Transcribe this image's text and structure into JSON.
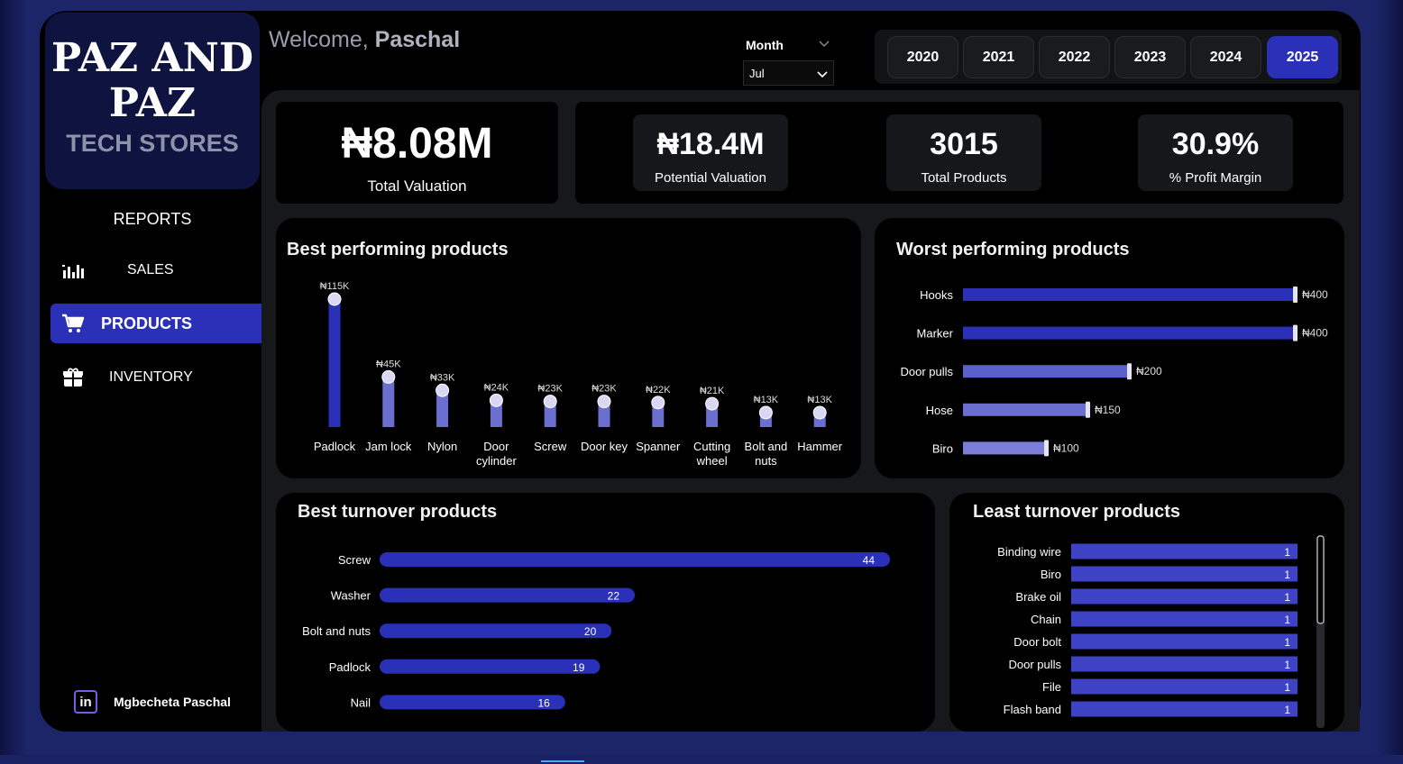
{
  "sidebar": {
    "logo_line1": "PAZ AND",
    "logo_line2": "PAZ",
    "logo_line3": "TECH STORES",
    "reports_title": "REPORTS",
    "nav": [
      {
        "label": "SALES",
        "icon": "sales-chart-icon"
      },
      {
        "label": "PRODUCTS",
        "icon": "cart-icon",
        "active": true
      },
      {
        "label": "INVENTORY",
        "icon": "inventory-box-icon"
      }
    ],
    "footer_name": "Mgbecheta Paschal",
    "footer_icon_text": "in"
  },
  "header": {
    "welcome_prefix": "Welcome,",
    "welcome_name": "Paschal",
    "month_label": "Month",
    "month_value": "Jul",
    "years": [
      "2020",
      "2021",
      "2022",
      "2023",
      "2024",
      "2025"
    ],
    "active_year": "2025"
  },
  "kpis": {
    "total_valuation": {
      "value": "₦8.08M",
      "label": "Total Valuation"
    },
    "cards": [
      {
        "value": "₦18.4M",
        "label": "Potential Valuation"
      },
      {
        "value": "3015",
        "label": "Total Products"
      },
      {
        "value": "30.9%",
        "label": "% Profit Margin"
      }
    ]
  },
  "colors": {
    "accent": "#2a31b8",
    "bar_dark": "#2a31b8",
    "bar_light": "#6a6fd0",
    "panel": "#17181c"
  },
  "chart_data": [
    {
      "type": "bar",
      "title": "Best performing products",
      "categories": [
        "Padlock",
        "Jam lock",
        "Nylon",
        "Door cylinder",
        "Screw",
        "Door key",
        "Spanner",
        "Cutting wheel",
        "Bolt and nuts",
        "Hammer"
      ],
      "category_lines": [
        [
          "Padlock"
        ],
        [
          "Jam lock"
        ],
        [
          "Nylon"
        ],
        [
          "Door",
          "cylinder"
        ],
        [
          "Screw"
        ],
        [
          "Door key"
        ],
        [
          "Spanner"
        ],
        [
          "Cutting",
          "wheel"
        ],
        [
          "Bolt and",
          "nuts"
        ],
        [
          "Hammer"
        ]
      ],
      "values": [
        115000,
        45000,
        33000,
        24000,
        23000,
        23000,
        22000,
        21000,
        13000,
        13000
      ],
      "labels": [
        "₦115K",
        "₦45K",
        "₦33K",
        "₦24K",
        "₦23K",
        "₦23K",
        "₦22K",
        "₦21K",
        "₦13K",
        "₦13K"
      ],
      "ylim": [
        0,
        115000
      ]
    },
    {
      "type": "bar",
      "orientation": "horizontal",
      "title": "Worst performing products",
      "categories": [
        "Hooks",
        "Marker",
        "Door pulls",
        "Hose",
        "Biro"
      ],
      "values": [
        400,
        400,
        200,
        150,
        100
      ],
      "labels": [
        "₦400",
        "₦400",
        "₦200",
        "₦150",
        "₦100"
      ],
      "xlim": [
        0,
        400
      ]
    },
    {
      "type": "bar",
      "orientation": "horizontal",
      "title": "Best turnover products",
      "categories": [
        "Screw",
        "Washer",
        "Bolt and nuts",
        "Padlock",
        "Nail"
      ],
      "values": [
        44,
        22,
        20,
        19,
        16
      ],
      "labels": [
        "44",
        "22",
        "20",
        "19",
        "16"
      ],
      "xlim": [
        0,
        44
      ]
    },
    {
      "type": "bar",
      "orientation": "horizontal",
      "title": "Least turnover products",
      "categories": [
        "Binding wire",
        "Biro",
        "Brake oil",
        "Chain",
        "Door bolt",
        "Door pulls",
        "File",
        "Flash band"
      ],
      "values": [
        1,
        1,
        1,
        1,
        1,
        1,
        1,
        1
      ],
      "labels": [
        "1",
        "1",
        "1",
        "1",
        "1",
        "1",
        "1",
        "1"
      ],
      "xlim": [
        0,
        1
      ]
    }
  ]
}
